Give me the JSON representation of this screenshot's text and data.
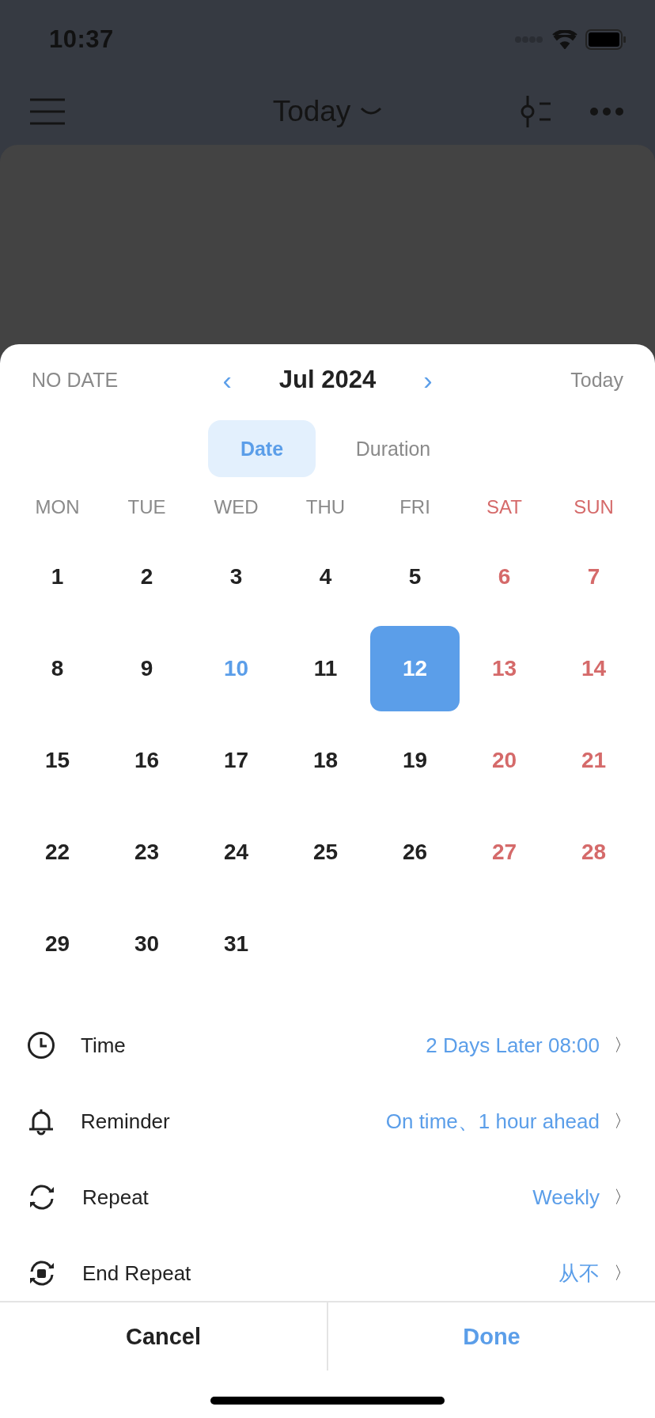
{
  "status_bar": {
    "time": "10:37"
  },
  "nav_bar": {
    "title": "Today"
  },
  "sheet": {
    "header": {
      "no_date": "NO DATE",
      "prev": "‹",
      "month": "Jul 2024",
      "next": "›",
      "today": "Today"
    },
    "tabs": [
      {
        "label": "Date",
        "selected": true
      },
      {
        "label": "Duration",
        "selected": false
      }
    ],
    "weekdays": [
      {
        "label": "MON",
        "kind": "weekday"
      },
      {
        "label": "TUE",
        "kind": "weekday"
      },
      {
        "label": "WED",
        "kind": "weekday"
      },
      {
        "label": "THU",
        "kind": "weekday"
      },
      {
        "label": "FRI",
        "kind": "weekday"
      },
      {
        "label": "SAT",
        "kind": "weekend"
      },
      {
        "label": "SUN",
        "kind": "weekend"
      }
    ],
    "days": [
      {
        "label": "1",
        "kind": "weekday",
        "selected": false
      },
      {
        "label": "2",
        "kind": "weekday",
        "selected": false
      },
      {
        "label": "3",
        "kind": "weekday",
        "selected": false
      },
      {
        "label": "4",
        "kind": "weekday",
        "selected": false
      },
      {
        "label": "5",
        "kind": "weekday",
        "selected": false
      },
      {
        "label": "6",
        "kind": "weekend",
        "selected": false
      },
      {
        "label": "7",
        "kind": "weekend",
        "selected": false
      },
      {
        "label": "8",
        "kind": "weekday",
        "selected": false
      },
      {
        "label": "9",
        "kind": "weekday",
        "selected": false
      },
      {
        "label": "10",
        "kind": "today",
        "selected": false
      },
      {
        "label": "11",
        "kind": "weekday",
        "selected": false
      },
      {
        "label": "12",
        "kind": "weekday",
        "selected": true
      },
      {
        "label": "13",
        "kind": "weekend",
        "selected": false
      },
      {
        "label": "14",
        "kind": "weekend",
        "selected": false
      },
      {
        "label": "15",
        "kind": "weekday",
        "selected": false
      },
      {
        "label": "16",
        "kind": "weekday",
        "selected": false
      },
      {
        "label": "17",
        "kind": "weekday",
        "selected": false
      },
      {
        "label": "18",
        "kind": "weekday",
        "selected": false
      },
      {
        "label": "19",
        "kind": "weekday",
        "selected": false
      },
      {
        "label": "20",
        "kind": "weekend",
        "selected": false
      },
      {
        "label": "21",
        "kind": "weekend",
        "selected": false
      },
      {
        "label": "22",
        "kind": "weekday",
        "selected": false
      },
      {
        "label": "23",
        "kind": "weekday",
        "selected": false
      },
      {
        "label": "24",
        "kind": "weekday",
        "selected": false
      },
      {
        "label": "25",
        "kind": "weekday",
        "selected": false
      },
      {
        "label": "26",
        "kind": "weekday",
        "selected": false
      },
      {
        "label": "27",
        "kind": "weekend",
        "selected": false
      },
      {
        "label": "28",
        "kind": "weekend",
        "selected": false
      },
      {
        "label": "29",
        "kind": "weekday",
        "selected": false
      },
      {
        "label": "30",
        "kind": "weekday",
        "selected": false
      },
      {
        "label": "31",
        "kind": "weekday",
        "selected": false
      }
    ],
    "settings": [
      {
        "kind": "time",
        "label": "Time",
        "value": "2 Days Later 08:00",
        "chevron": "〉"
      },
      {
        "kind": "reminder",
        "label": "Reminder",
        "value": "On time、1 hour ahead",
        "chevron": "〉"
      },
      {
        "kind": "repeat",
        "label": "Repeat",
        "value": "Weekly",
        "chevron": "〉"
      },
      {
        "kind": "end_repeat",
        "label": "End Repeat",
        "value": "从不",
        "chevron": "〉"
      }
    ],
    "buttons": [
      {
        "kind": "cancel",
        "label": "Cancel"
      },
      {
        "kind": "done",
        "label": "Done"
      }
    ]
  }
}
